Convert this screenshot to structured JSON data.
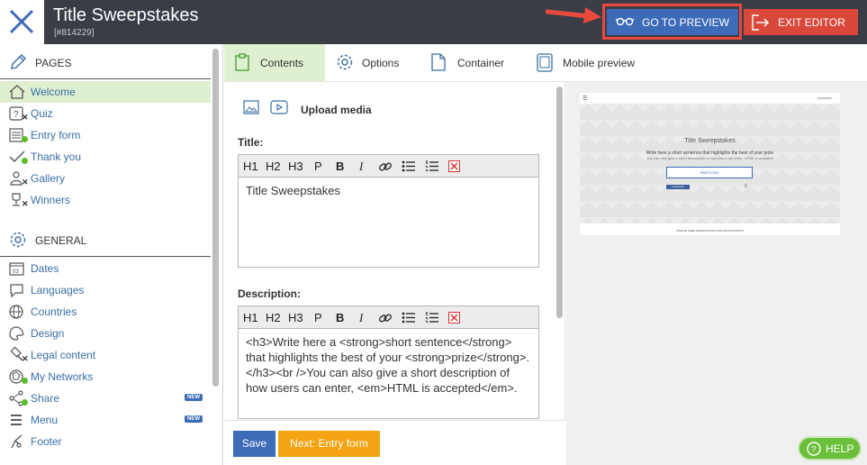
{
  "header": {
    "title": "Title Sweepstakes",
    "id": "[#814229]",
    "preview_label": "GO TO PREVIEW",
    "exit_label": "EXIT EDITOR",
    "accent_blue": "#3d6bb8",
    "accent_red": "#d9483b",
    "highlight_red": "#e8493f"
  },
  "sidebar": {
    "pages_title": "PAGES",
    "pages": [
      {
        "label": "Welcome",
        "icon": "home-icon",
        "active": true
      },
      {
        "label": "Quiz",
        "icon": "question-icon"
      },
      {
        "label": "Entry form",
        "icon": "form-icon"
      },
      {
        "label": "Thank you",
        "icon": "check-icon"
      },
      {
        "label": "Gallery",
        "icon": "gallery-icon"
      },
      {
        "label": "Winners",
        "icon": "trophy-icon"
      }
    ],
    "general_title": "GENERAL",
    "general": [
      {
        "label": "Dates",
        "icon": "calendar-icon",
        "icon_text": "03"
      },
      {
        "label": "Languages",
        "icon": "speech-bubble-icon"
      },
      {
        "label": "Countries",
        "icon": "globe-icon"
      },
      {
        "label": "Design",
        "icon": "palette-icon"
      },
      {
        "label": "Legal content",
        "icon": "gavel-icon"
      },
      {
        "label": "My Networks",
        "icon": "network-icon"
      },
      {
        "label": "Share",
        "icon": "share-icon",
        "badge": "NEW"
      },
      {
        "label": "Menu",
        "icon": "menu-icon",
        "badge": "NEW"
      },
      {
        "label": "Footer",
        "icon": "footer-icon"
      }
    ]
  },
  "tabs": [
    {
      "label": "Contents",
      "icon": "clipboard-icon",
      "active": true
    },
    {
      "label": "Options",
      "icon": "gear-icon"
    },
    {
      "label": "Container",
      "icon": "document-icon"
    },
    {
      "label": "Mobile preview",
      "icon": "tablet-icon"
    }
  ],
  "editor": {
    "upload_label": "Upload media",
    "title_label": "Title:",
    "title_value": "Title Sweepstakes",
    "description_label": "Description:",
    "description_value": "<h3>Write here a <strong>short sentence</strong> that highlights the best of your <strong>prize</strong>.</h3><br />You can also give a short description of how users can enter, <em>HTML is accepted</em>.",
    "toolbar": [
      "H1",
      "H2",
      "H3",
      "P"
    ],
    "save_label": "Save",
    "next_label": "Next: Entry form"
  },
  "preview": {
    "title": "Title Sweepstakes",
    "subtitle": "Write here a short sentence that highlights the best of your prize",
    "subline": "You can also give a short description of how users can enter, HTML is accepted",
    "button": "PARTICIPA",
    "like": "Facebook",
    "count": "0",
    "share": "CONDIVIDI",
    "footer": "CREATE FREE SWEEPSTAKES WITH EASYPROMOS"
  },
  "help_label": "HELP"
}
